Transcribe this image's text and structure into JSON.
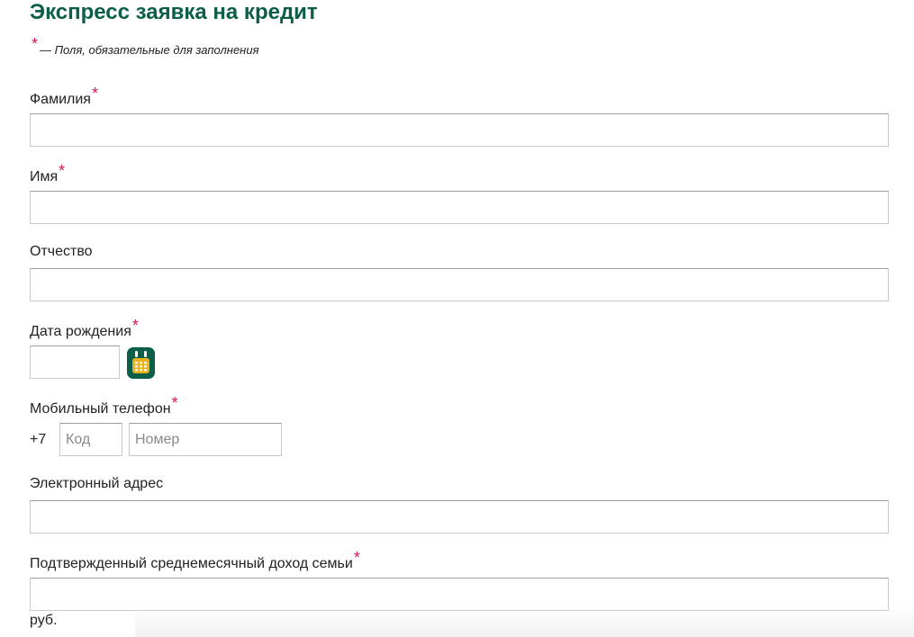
{
  "title": "Экспресс заявка на кредит",
  "required_note": {
    "marker": "*",
    "text": "— Поля, обязательные для заполнения"
  },
  "fields": {
    "last_name": {
      "label": "Фамилия",
      "required": true,
      "value": ""
    },
    "first_name": {
      "label": "Имя",
      "required": true,
      "value": ""
    },
    "middle_name": {
      "label": "Отчество",
      "required": false,
      "value": ""
    },
    "birth_date": {
      "label": "Дата рождения",
      "required": true,
      "value": ""
    },
    "mobile_phone": {
      "label": "Мобильный телефон",
      "required": true,
      "country_prefix": "+7",
      "code_placeholder": "Код",
      "number_placeholder": "Номер"
    },
    "email": {
      "label": "Электронный адрес",
      "required": false,
      "value": ""
    },
    "income": {
      "label": "Подтвержденный среднемесячный доход семьи",
      "required": true,
      "value": "",
      "unit": "руб."
    }
  },
  "icons": {
    "calendar": "calendar-icon"
  },
  "colors": {
    "accent": "#0b5e47",
    "required_marker": "#d6175b",
    "calendar_face": "#e9b21d"
  }
}
